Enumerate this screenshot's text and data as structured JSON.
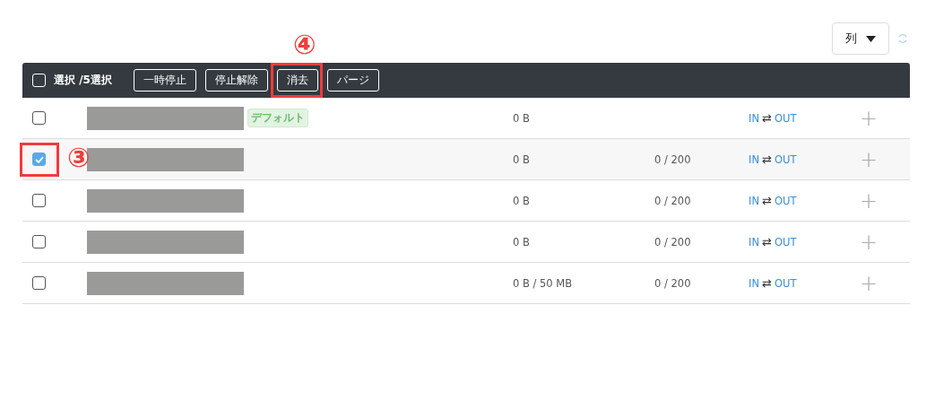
{
  "toolbar": {
    "columns_button": "列"
  },
  "table": {
    "header": {
      "select_all_checked": false,
      "selection_label": "選択 /5選択",
      "actions": [
        {
          "label": "一時停止"
        },
        {
          "label": "停止解除"
        },
        {
          "label": "消去",
          "callout": "④"
        },
        {
          "label": "パージ"
        }
      ]
    },
    "rows": [
      {
        "checked": false,
        "tag": "デフォルト",
        "size": "0 B",
        "in": "IN",
        "arrow": "⇄",
        "out": "OUT",
        "action": "+"
      },
      {
        "checked": true,
        "callout": "③",
        "size": "0 B",
        "count": "0 / 200",
        "in": "IN",
        "arrow": "⇄",
        "out": "OUT",
        "action": "+"
      },
      {
        "checked": false,
        "size": "0 B",
        "count": "0 / 200",
        "in": "IN",
        "arrow": "⇄",
        "out": "OUT",
        "action": "+"
      },
      {
        "checked": false,
        "size": "0 B",
        "count": "0 / 200",
        "in": "IN",
        "arrow": "⇄",
        "out": "OUT",
        "action": "+"
      },
      {
        "checked": false,
        "size": "0 B / 50 MB",
        "count": "0 / 200",
        "in": "IN",
        "arrow": "⇄",
        "out": "OUT",
        "action": "+"
      }
    ]
  }
}
